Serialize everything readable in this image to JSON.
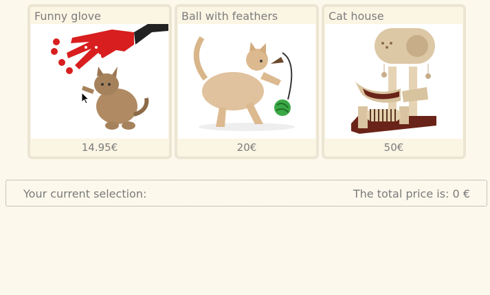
{
  "products": [
    {
      "title": "Funny glove",
      "price": "14.95€",
      "image": "kitten-with-red-glove-image"
    },
    {
      "title": "Ball with feathers",
      "price": "20€",
      "image": "cat-with-feather-ball-image"
    },
    {
      "title": "Cat house",
      "price": "50€",
      "image": "cat-house-tower-image"
    }
  ],
  "selection": {
    "label": "Your current selection:",
    "total_prefix": "The total price is:",
    "total_value": "0",
    "currency": "€"
  },
  "colors": {
    "background": "#fcf8ec",
    "card_border": "#ece5d3",
    "text": "#7a7a7a",
    "glove_red": "#d81e1e"
  }
}
